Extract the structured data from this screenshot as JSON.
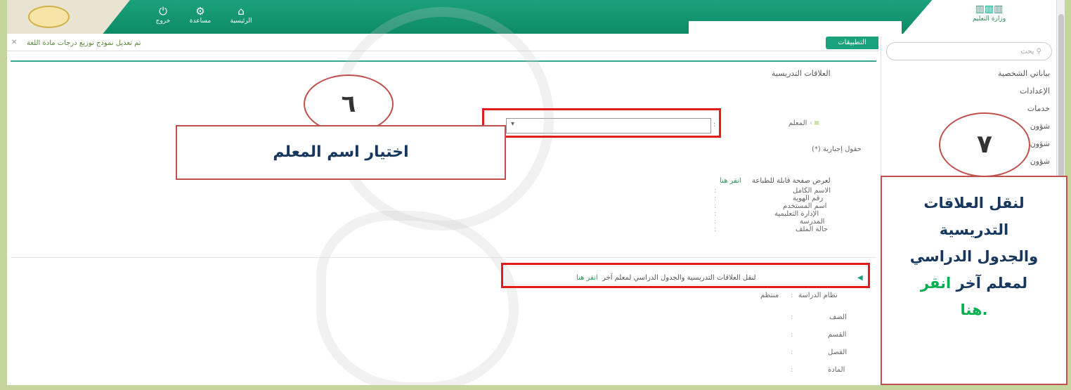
{
  "topnav": {
    "logout_label": "خروج",
    "help_label": "مساعدة",
    "home_label": "الرئيسية",
    "brand_text": "وزارة التعليم"
  },
  "notice": {
    "close_symbol": "✕",
    "text": "تم تعديل نموذج توزيع درجات مادة اللغة"
  },
  "tab": {
    "apps_label": "التطبيقات"
  },
  "sidebar": {
    "search_placeholder": "بحث",
    "items": [
      "بياناتي الشخصية",
      "الإعدادات",
      "خدمات",
      "شؤون",
      "شؤون",
      "شؤون"
    ]
  },
  "main": {
    "section_title": "العلاقات التدريسية",
    "teacher_label": "المعلم",
    "required_note": "(*) حقول إجبارية",
    "print_link_prefix": "لعرض صفحة قابلة للطباعة",
    "print_link": "انقر هنا",
    "info_fields": [
      "الاسم الكامل",
      "رقم الهوية",
      "اسم المستخدم",
      "الإدارة التعليمية",
      "المدرسة",
      "حالة الملف"
    ],
    "transfer_text": "لنقل العلاقات التدريسية والجدول الدراسي لمعلم آخر",
    "transfer_link": "انقر هنا",
    "study_system_label": "نظام الدراسة",
    "study_system_value": "منتظم",
    "class_fields": [
      "الصف",
      "القسم",
      "الفصل",
      "المادة"
    ]
  },
  "annotations": {
    "step6_number": "٦",
    "step6_label": "اختيار اسم المعلم",
    "step7_number": "٧",
    "step7_label_line1": "لنقل العلاقات",
    "step7_label_line2": "التدريسية",
    "step7_label_line3": "والجدول الدراسي",
    "step7_label_line4a": "لمعلم آخر",
    "step7_label_line4b": "انقر",
    "step7_label_line5": "هنا."
  },
  "colors": {
    "header_green": "#1aa27c",
    "highlight_red": "#e31b1b",
    "annotation_text": "#17375e",
    "link_green": "#00b050",
    "page_background": "#c3d69b"
  }
}
